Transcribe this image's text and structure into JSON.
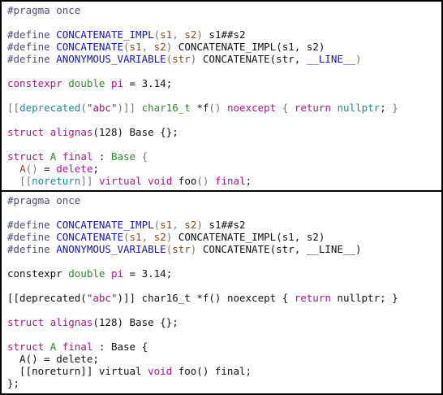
{
  "colors": {
    "background": "#ffffff",
    "border": "#000000",
    "plain": "#111111",
    "preprocessor": "#4c4c7a",
    "macro": "#1414c8",
    "param": "#8a4a1e",
    "keyword": "#b3138c",
    "type": "#2a8a2a",
    "builtin": "#1f8a8a",
    "string": "#b0106a",
    "func": "#111111",
    "punct": "#777777"
  },
  "top_editor": {
    "lines": [
      [
        [
          "preprocessor",
          "#pragma once"
        ]
      ],
      [],
      [
        [
          "preprocessor",
          "#define "
        ],
        [
          "macro",
          "CONCATENATE_IMPL"
        ],
        [
          "punct",
          "("
        ],
        [
          "param",
          "s1"
        ],
        [
          "punct",
          ", "
        ],
        [
          "param",
          "s2"
        ],
        [
          "punct",
          ")"
        ],
        [
          "plain",
          " s1##s2"
        ]
      ],
      [
        [
          "preprocessor",
          "#define "
        ],
        [
          "macro",
          "CONCATENATE"
        ],
        [
          "punct",
          "("
        ],
        [
          "param",
          "s1"
        ],
        [
          "punct",
          ", "
        ],
        [
          "param",
          "s2"
        ],
        [
          "punct",
          ")"
        ],
        [
          "plain",
          " CONCATENATE_IMPL(s1, s2)"
        ]
      ],
      [
        [
          "preprocessor",
          "#define "
        ],
        [
          "macro",
          "ANONYMOUS_VARIABLE"
        ],
        [
          "punct",
          "("
        ],
        [
          "param",
          "str"
        ],
        [
          "punct",
          ")"
        ],
        [
          "plain",
          " CONCATENATE(str, "
        ],
        [
          "macro",
          "__LINE__"
        ],
        [
          "punct",
          ")"
        ]
      ],
      [],
      [
        [
          "keyword",
          "constexpr"
        ],
        [
          "plain",
          " "
        ],
        [
          "type",
          "double"
        ],
        [
          "plain",
          " "
        ],
        [
          "keyword",
          "pi"
        ],
        [
          "plain",
          " = 3.14;"
        ]
      ],
      [],
      [
        [
          "punct",
          "[["
        ],
        [
          "builtin",
          "deprecated"
        ],
        [
          "punct",
          "("
        ],
        [
          "string",
          "\"abc\""
        ],
        [
          "punct",
          ")]]"
        ],
        [
          "plain",
          " "
        ],
        [
          "type",
          "char16_t"
        ],
        [
          "plain",
          " *f"
        ],
        [
          "punct",
          "()"
        ],
        [
          "plain",
          " "
        ],
        [
          "keyword",
          "noexcept"
        ],
        [
          "plain",
          " "
        ],
        [
          "punct",
          "{"
        ],
        [
          "plain",
          " "
        ],
        [
          "keyword",
          "return"
        ],
        [
          "plain",
          " "
        ],
        [
          "builtin",
          "nullptr"
        ],
        [
          "plain",
          "; "
        ],
        [
          "punct",
          "}"
        ]
      ],
      [],
      [
        [
          "keyword",
          "struct"
        ],
        [
          "plain",
          " "
        ],
        [
          "keyword",
          "alignas"
        ],
        [
          "plain",
          "(128) Base {};"
        ]
      ],
      [],
      [
        [
          "keyword",
          "struct"
        ],
        [
          "plain",
          " "
        ],
        [
          "type",
          "A"
        ],
        [
          "plain",
          " "
        ],
        [
          "keyword",
          "final"
        ],
        [
          "plain",
          " : "
        ],
        [
          "type",
          "Base"
        ],
        [
          "plain",
          " "
        ],
        [
          "punct",
          "{"
        ]
      ],
      [
        [
          "plain",
          "  "
        ],
        [
          "param",
          "A"
        ],
        [
          "punct",
          "()"
        ],
        [
          "plain",
          " = "
        ],
        [
          "keyword",
          "delete"
        ],
        [
          "plain",
          ";"
        ]
      ],
      [
        [
          "plain",
          "  "
        ],
        [
          "punct",
          "[["
        ],
        [
          "builtin",
          "noreturn"
        ],
        [
          "punct",
          "]]"
        ],
        [
          "plain",
          " "
        ],
        [
          "keyword",
          "virtual"
        ],
        [
          "plain",
          " "
        ],
        [
          "keyword",
          "void"
        ],
        [
          "plain",
          " foo"
        ],
        [
          "punct",
          "()"
        ],
        [
          "plain",
          " "
        ],
        [
          "keyword",
          "final"
        ],
        [
          "plain",
          ";"
        ]
      ]
    ]
  },
  "bottom_editor": {
    "lines": [
      [
        [
          "preprocessor",
          "#pragma once"
        ]
      ],
      [],
      [
        [
          "preprocessor",
          "#define "
        ],
        [
          "macro",
          "CONCATENATE_IMPL"
        ],
        [
          "punct",
          "("
        ],
        [
          "param",
          "s1"
        ],
        [
          "punct",
          ", "
        ],
        [
          "param",
          "s2"
        ],
        [
          "punct",
          ")"
        ],
        [
          "plain",
          " s1##s2"
        ]
      ],
      [
        [
          "preprocessor",
          "#define "
        ],
        [
          "macro",
          "CONCATENATE"
        ],
        [
          "punct",
          "("
        ],
        [
          "param",
          "s1"
        ],
        [
          "punct",
          ", "
        ],
        [
          "param",
          "s2"
        ],
        [
          "punct",
          ")"
        ],
        [
          "plain",
          " CONCATENATE_IMPL(s1, s2)"
        ]
      ],
      [
        [
          "preprocessor",
          "#define "
        ],
        [
          "macro",
          "ANONYMOUS_VARIABLE"
        ],
        [
          "punct",
          "("
        ],
        [
          "param",
          "str"
        ],
        [
          "punct",
          ")"
        ],
        [
          "plain",
          " CONCATENATE(str, __LINE__)"
        ]
      ],
      [],
      [
        [
          "plain",
          "constexpr "
        ],
        [
          "type",
          "double"
        ],
        [
          "plain",
          " "
        ],
        [
          "keyword",
          "pi"
        ],
        [
          "plain",
          " = 3.14;"
        ]
      ],
      [],
      [
        [
          "plain",
          "[[deprecated("
        ],
        [
          "string",
          "\"abc\""
        ],
        [
          "plain",
          ")]] char16_t *f() noexcept { "
        ],
        [
          "keyword",
          "return"
        ],
        [
          "plain",
          " nullptr; }"
        ]
      ],
      [],
      [
        [
          "keyword",
          "struct"
        ],
        [
          "plain",
          " "
        ],
        [
          "keyword",
          "alignas"
        ],
        [
          "plain",
          "(128) Base {};"
        ]
      ],
      [],
      [
        [
          "keyword",
          "struct"
        ],
        [
          "plain",
          " "
        ],
        [
          "type",
          "A"
        ],
        [
          "plain",
          " "
        ],
        [
          "keyword",
          "final"
        ],
        [
          "plain",
          " : Base {"
        ]
      ],
      [
        [
          "plain",
          "  A() = delete;"
        ]
      ],
      [
        [
          "plain",
          "  [[noreturn]] virtual "
        ],
        [
          "keyword",
          "void"
        ],
        [
          "plain",
          " foo() final;"
        ]
      ],
      [
        [
          "plain",
          "};"
        ]
      ]
    ]
  }
}
